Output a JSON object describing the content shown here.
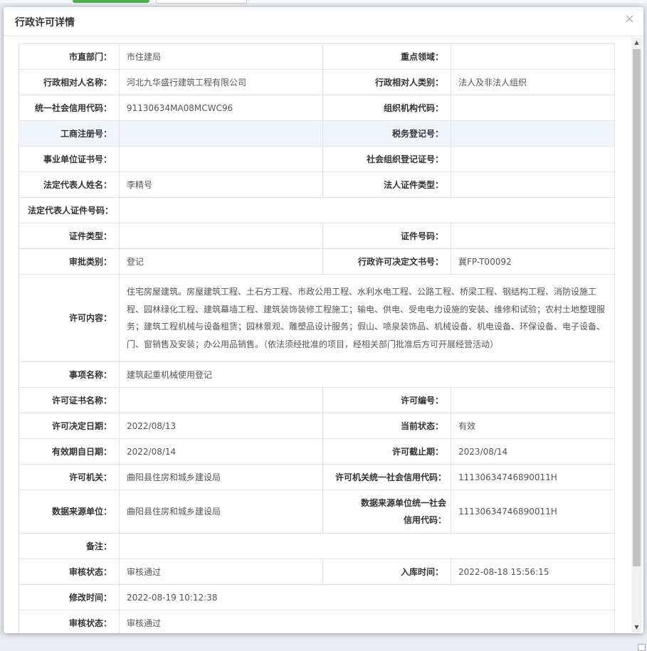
{
  "modal": {
    "title": "行政许可详情",
    "close": "×"
  },
  "rows": [
    {
      "l1": "市直部门：",
      "v1": "市住建局",
      "l2": "重点领域：",
      "v2": ""
    },
    {
      "l1": "行政相对人名称：",
      "v1": "河北九华盛行建筑工程有限公司",
      "l2": "行政相对人类别：",
      "v2": "法人及非法人组织"
    },
    {
      "l1": "统一社会信用代码：",
      "v1": "91130634MA08MCWC96",
      "l2": "组织机构代码：",
      "v2": ""
    },
    {
      "l1": "工商注册号：",
      "v1": "",
      "l2": "税务登记号：",
      "v2": ""
    },
    {
      "l1": "事业单位证书号：",
      "v1": "",
      "l2": "社会组织登记证号：",
      "v2": ""
    },
    {
      "l1": "法定代表人姓名：",
      "v1": "李精号",
      "l2": "法人证件类型：",
      "v2": ""
    },
    {
      "l1": "法定代表人证件号码：",
      "v1": ""
    },
    {
      "l1": "证件类型：",
      "v1": "",
      "l2": "证件号码：",
      "v2": ""
    },
    {
      "l1": "审批类别：",
      "v1": "登记",
      "l2": "行政许可决定文书号：",
      "v2": "冀FP-T00092"
    },
    {
      "l1": "许可内容：",
      "v1": "住宅房屋建筑。房屋建筑工程、土石方工程、市政公用工程、水利水电工程、公路工程、桥梁工程、钢结构工程、消防设施工程、园林绿化工程、建筑幕墙工程、建筑装饰装修工程施工；输电、供电、受电电力设施的安装、维修和试验；农村土地整理服务；建筑工程机械与设备租赁；园林景观、雕塑品设计服务；假山、喷泉装饰品、机械设备、机电设备、环保设备、电子设备、门、窗销售及安装；办公用品销售。（依法须经批准的项目，经相关部门批准后方可开展经营活动）"
    },
    {
      "l1": "事项名称：",
      "v1": "建筑起重机械使用登记"
    },
    {
      "l1": "许可证书名称：",
      "v1": "",
      "l2": "许可编号：",
      "v2": ""
    },
    {
      "l1": "许可决定日期：",
      "v1": "2022/08/13",
      "l2": "当前状态：",
      "v2": "有效"
    },
    {
      "l1": "有效期自日期：",
      "v1": "2022/08/14",
      "l2": "许可截止期：",
      "v2": "2023/08/14"
    },
    {
      "l1": "许可机关：",
      "v1": "曲阳县住房和城乡建设局",
      "l2": "许可机关统一社会信用代码：",
      "v2": "11130634746890011H"
    },
    {
      "l1": "数据来源单位：",
      "v1": "曲阳县住房和城乡建设局",
      "l2": "数据来源单位统一社会信用代码：",
      "v2": "11130634746890011H"
    },
    {
      "l1": "备注：",
      "v1": ""
    },
    {
      "l1": "审核状态：",
      "v1": "审核通过",
      "l2": "入库时间：",
      "v2": "2022-08-18 15:56:15"
    },
    {
      "l1": "修改时间：",
      "v1": "2022-08-19 10:12:38"
    },
    {
      "l1": "审核状态：",
      "v1": "审核通过"
    }
  ],
  "icons": {
    "scroll_up": "arrow-up-icon",
    "scroll_down": "arrow-down-icon",
    "close": "close-icon"
  }
}
